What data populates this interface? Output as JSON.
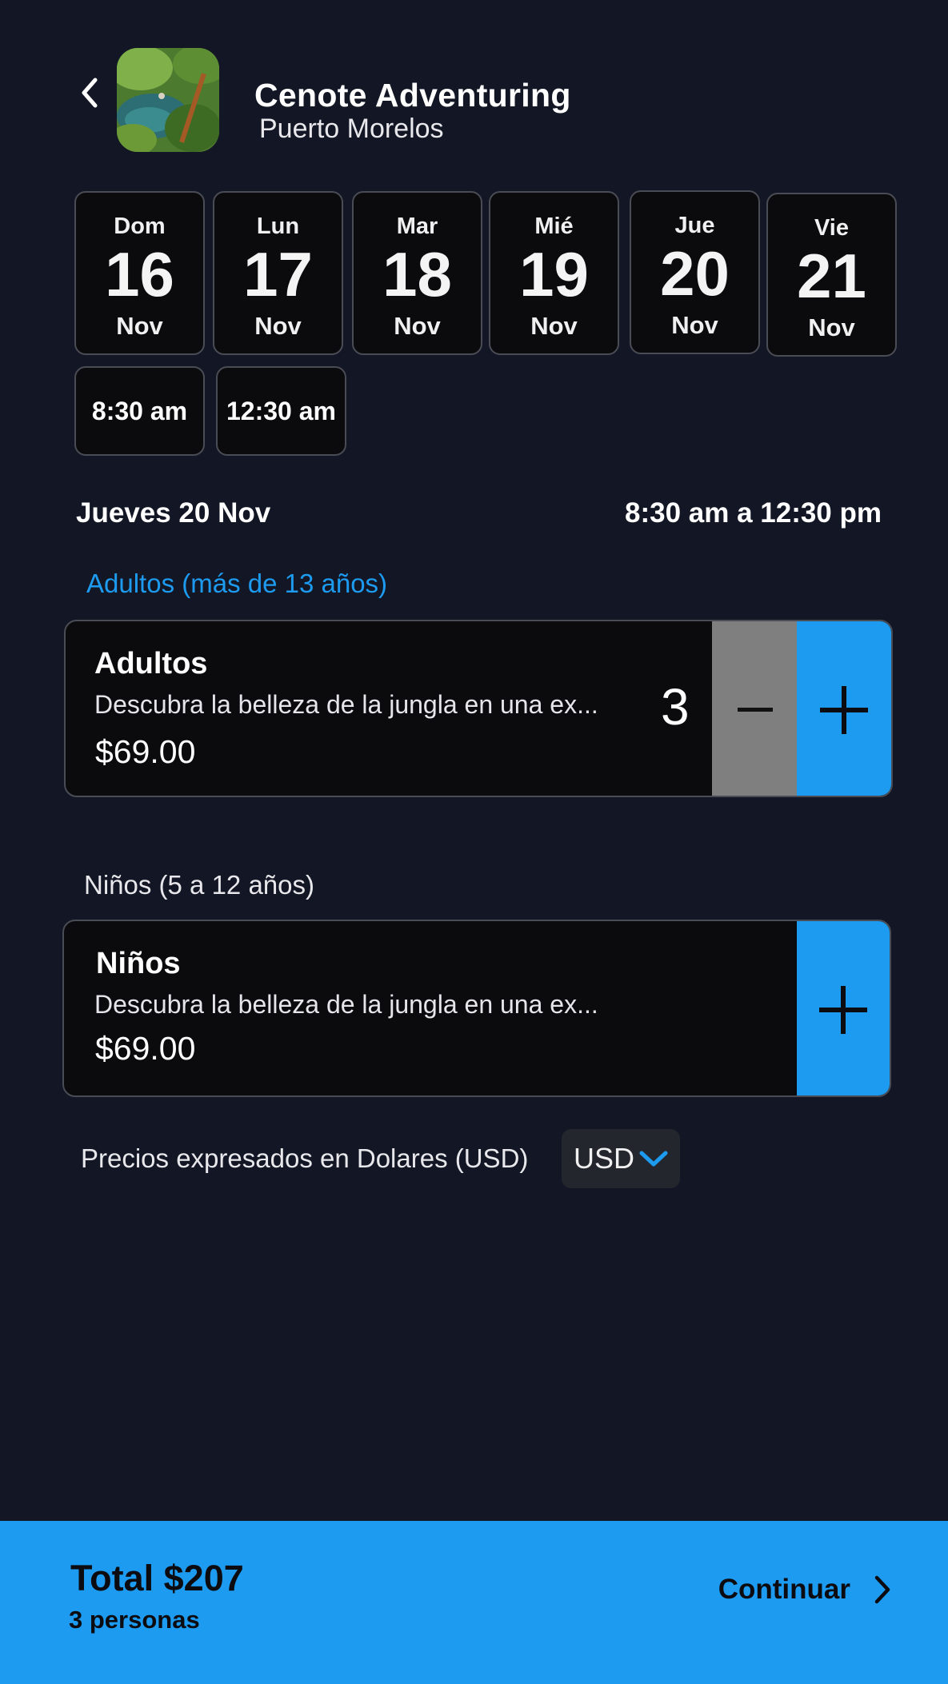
{
  "header": {
    "title": "Cenote Adventuring",
    "subtitle": "Puerto Morelos"
  },
  "dates": [
    {
      "dow": "Dom",
      "day": "16",
      "month": "Nov"
    },
    {
      "dow": "Lun",
      "day": "17",
      "month": "Nov"
    },
    {
      "dow": "Mar",
      "day": "18",
      "month": "Nov"
    },
    {
      "dow": "Mié",
      "day": "19",
      "month": "Nov"
    },
    {
      "dow": "Jue",
      "day": "20",
      "month": "Nov"
    },
    {
      "dow": "Vie",
      "day": "21",
      "month": "Nov"
    }
  ],
  "times": [
    "8:30 am",
    "12:30 am"
  ],
  "summary": {
    "date": "Jueves 20 Nov",
    "time": "8:30 am a 12:30 pm"
  },
  "adults": {
    "section_label": "Adultos (más de 13 años)",
    "name": "Adultos",
    "description": "Descubra la belleza de la jungla en una ex...",
    "price": "$69.00",
    "quantity": "3"
  },
  "children": {
    "section_label": "Niños (5 a 12 años)",
    "name": "Niños",
    "description": "Descubra la belleza de la jungla en una ex...",
    "price": "$69.00"
  },
  "currency": {
    "note": "Precios expresados en Dolares (USD)",
    "selected": "USD"
  },
  "footer": {
    "total": "Total $207",
    "persons": "3 personas",
    "continue_label": "Continuar"
  },
  "colors": {
    "background": "#131624",
    "accent": "#1d9bf0",
    "minus_button": "#7f7f7f"
  },
  "icons": {
    "back": "chevron-left-icon",
    "plus": "plus-icon",
    "minus": "minus-icon",
    "dropdown": "chevron-down-icon",
    "continue": "chevron-right-icon"
  }
}
